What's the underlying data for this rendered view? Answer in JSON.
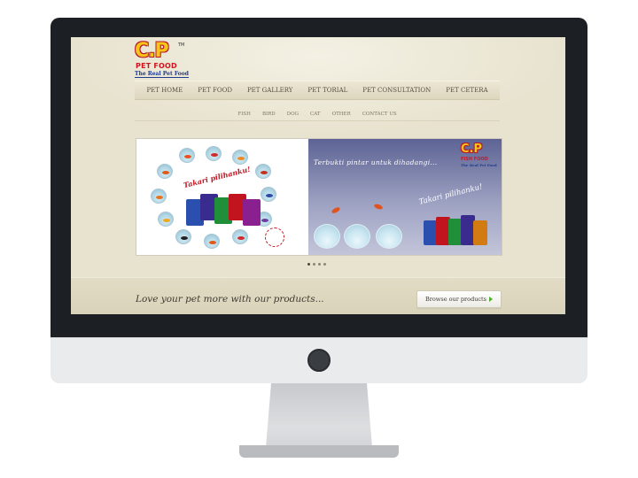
{
  "logo": {
    "brand": "C.P",
    "tm": "TM",
    "subtitle": "PET FOOD",
    "tagline": "The Real Pet Food"
  },
  "main_nav": [
    {
      "label": "PET HOME"
    },
    {
      "label": "PET FOOD"
    },
    {
      "label": "PET GALLERY"
    },
    {
      "label": "PET TORIAL"
    },
    {
      "label": "PET CONSULTATION"
    },
    {
      "label": "PET CETERA"
    }
  ],
  "sub_nav": [
    {
      "label": "FISH"
    },
    {
      "label": "BIRD"
    },
    {
      "label": "DOG"
    },
    {
      "label": "CAT"
    },
    {
      "label": "OTHER"
    },
    {
      "label": "CONTACT US"
    }
  ],
  "banner": {
    "left_slogan": "Takari pilihanku!",
    "right_brand": "C.P",
    "right_subtitle": "FISH FOOD",
    "right_tagline": "The Real Pet Food",
    "right_headline": "Terbukti pintar untuk dihadangi...",
    "right_slogan": "Takari pilihanku!"
  },
  "carousel": {
    "slide_count": 4,
    "active_index": 0
  },
  "footer": {
    "tagline": "Love your pet more with our products...",
    "button_label": "Browse our products"
  },
  "colors": {
    "page_bg": "#e8e3cf",
    "brand_yellow": "#f6c518",
    "brand_red": "#d4131f",
    "accent_green": "#4caf2a",
    "monitor_bezel": "#1c1f23"
  }
}
